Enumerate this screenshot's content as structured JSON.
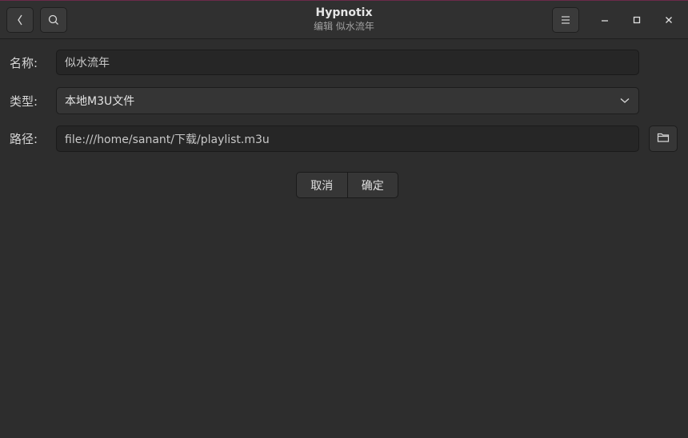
{
  "window": {
    "title": "Hypnotix",
    "subtitle": "编辑 似水流年"
  },
  "headerbar": {
    "back_icon": "chevron-left-icon",
    "search_icon": "search-icon",
    "menu_icon": "hamburger-menu-icon",
    "minimize_icon": "minimize-icon",
    "maximize_icon": "maximize-icon",
    "close_icon": "close-icon"
  },
  "form": {
    "name_label": "名称:",
    "name_value": "似水流年",
    "type_label": "类型:",
    "type_value": "本地M3U文件",
    "path_label": "路径:",
    "path_value": "file:///home/sanant/下载/playlist.m3u"
  },
  "actions": {
    "cancel_label": "取消",
    "ok_label": "确定"
  },
  "colors": {
    "window_bg": "#2d2d2d",
    "headerbar_bg": "#303030",
    "field_bg": "#262626",
    "accent_border": "#6b2a4a"
  }
}
